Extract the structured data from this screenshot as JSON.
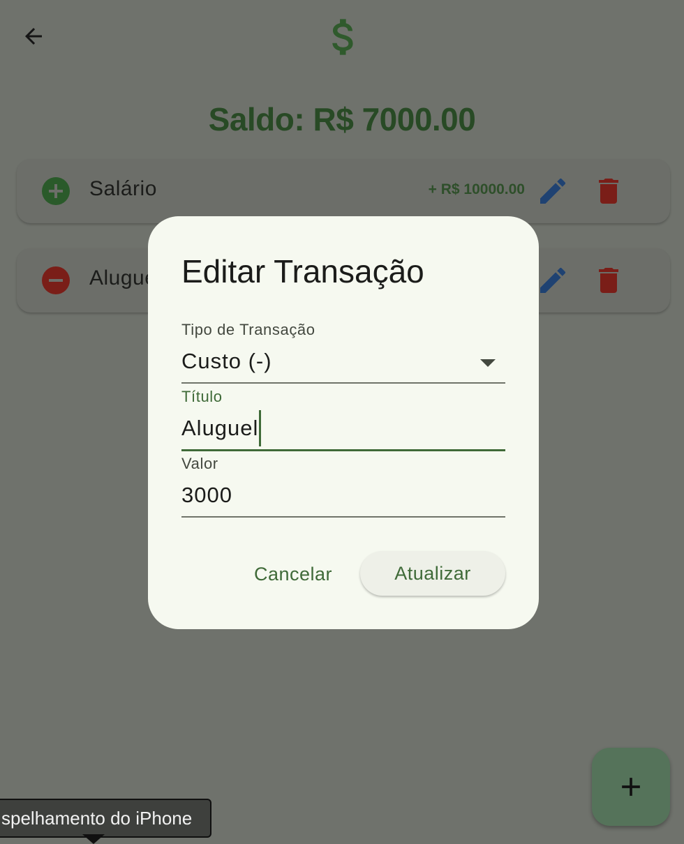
{
  "app": {
    "balance_text": "Saldo: R$ 7000.00",
    "logo_icon": "dollar-icon",
    "back_icon": "arrow-back-icon"
  },
  "transactions": [
    {
      "title": "Salário",
      "amount": "+ R$ 10000.00",
      "type": "income",
      "type_icon": "plus-circle-icon"
    },
    {
      "title": "Aluguel",
      "amount": "",
      "type": "expense",
      "type_icon": "minus-circle-icon"
    }
  ],
  "dialog": {
    "title": "Editar Transação",
    "type_field": {
      "label": "Tipo de Transação",
      "value": "Custo (-)"
    },
    "title_field": {
      "label": "Título",
      "value": "Aluguel"
    },
    "value_field": {
      "label": "Valor",
      "value": "3000"
    },
    "cancel_label": "Cancelar",
    "update_label": "Atualizar"
  },
  "fab": {
    "icon": "plus-icon"
  },
  "tooltip": {
    "text": "spelhamento do iPhone"
  },
  "colors": {
    "primary": "#3f6a38",
    "income": "#2e7d32",
    "expense": "#b3261e",
    "edit": "#2f5a9a",
    "dialog_bg": "#f6f9f0",
    "scrim_bg": "#6f726c"
  }
}
